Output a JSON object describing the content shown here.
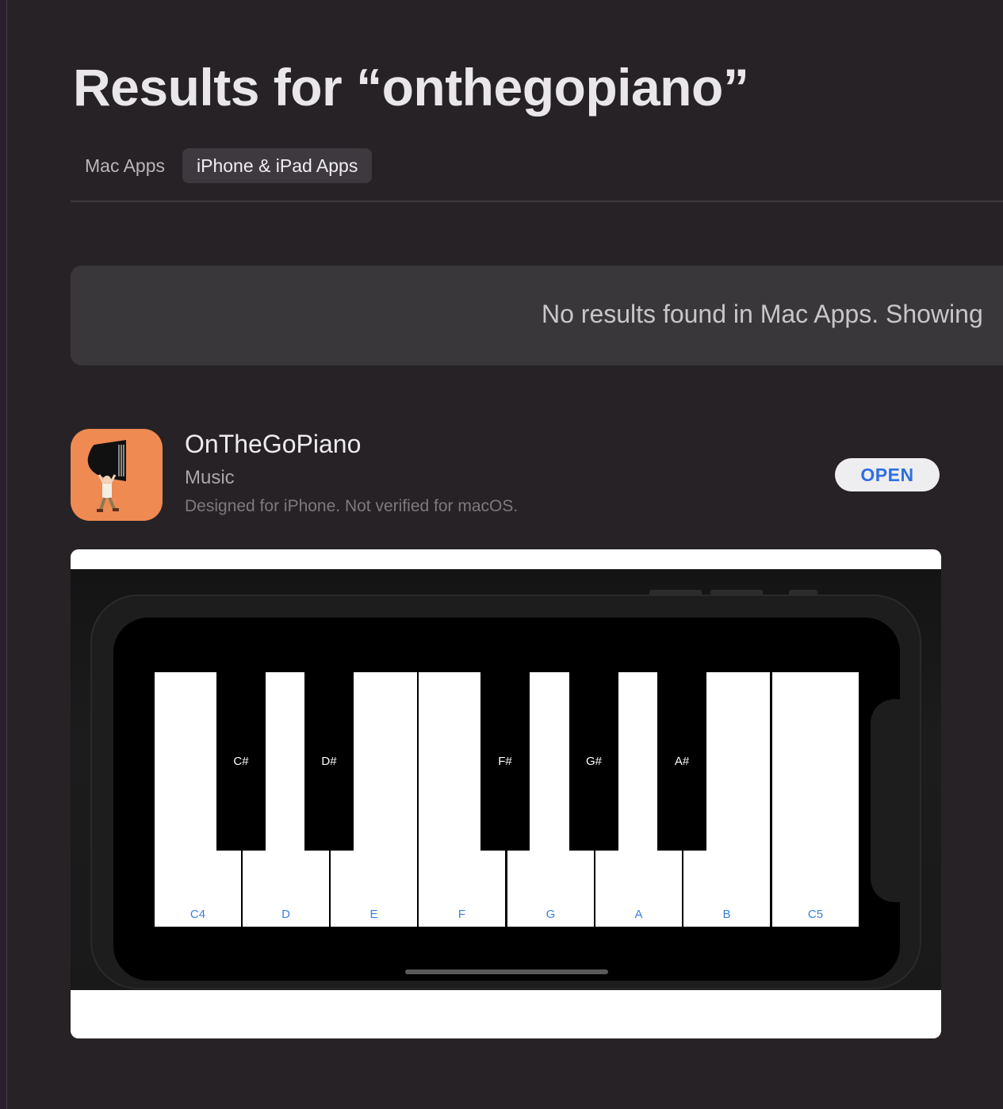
{
  "page": {
    "title": "Results for “onthegopiano”"
  },
  "tabs": [
    {
      "label": "Mac Apps",
      "active": false
    },
    {
      "label": "iPhone & iPad Apps",
      "active": true
    }
  ],
  "notice": {
    "text": "No results found in Mac Apps. Showing"
  },
  "app": {
    "name": "OnTheGoPiano",
    "category": "Music",
    "note": "Designed for iPhone. Not verified for macOS.",
    "action_label": "OPEN",
    "icon_name": "piano-mover-icon",
    "icon_bg": "#ee8a52"
  },
  "screenshot": {
    "white_keys": [
      "C4",
      "D",
      "E",
      "F",
      "G",
      "A",
      "B",
      "C5"
    ],
    "black_keys": [
      "C#",
      "D#",
      "F#",
      "G#",
      "A#"
    ],
    "label_color": "#3a7fe0"
  },
  "colors": {
    "background": "#272226",
    "accent": "#2f6fe0"
  }
}
